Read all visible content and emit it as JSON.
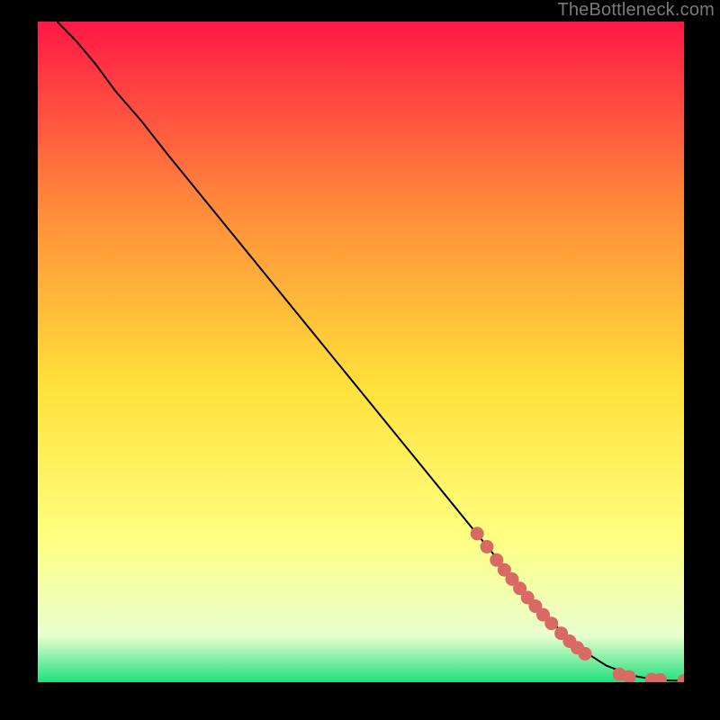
{
  "watermark": "TheBottleneck.com",
  "colors": {
    "gradient_top": "#ff1846",
    "gradient_mid_upper": "#ff8a3a",
    "gradient_mid": "#ffe13a",
    "gradient_mid_lower": "#ffff80",
    "gradient_lower": "#e8ffcf",
    "gradient_bottom": "#1fe07e",
    "curve": "#000000",
    "marker": "#d86a63",
    "frame": "#000000"
  },
  "chart_data": {
    "type": "line",
    "title": "",
    "xlabel": "",
    "ylabel": "",
    "xlim": [
      0,
      100
    ],
    "ylim": [
      0,
      100
    ],
    "series": [
      {
        "name": "curve",
        "x": [
          3,
          6,
          9,
          12,
          16,
          20,
          30,
          40,
          50,
          60,
          70,
          78,
          84,
          88,
          92,
          96,
          100
        ],
        "y": [
          100,
          97,
          93.5,
          89.5,
          85,
          80,
          68,
          56,
          44,
          32,
          20,
          10.5,
          5,
          2.5,
          1,
          0.3,
          0.2
        ]
      }
    ],
    "markers": [
      {
        "x": 68,
        "y": 22.5
      },
      {
        "x": 69.5,
        "y": 20.5
      },
      {
        "x": 71,
        "y": 18.5
      },
      {
        "x": 72.2,
        "y": 17
      },
      {
        "x": 73.4,
        "y": 15.6
      },
      {
        "x": 74.6,
        "y": 14.2
      },
      {
        "x": 75.8,
        "y": 12.8
      },
      {
        "x": 77,
        "y": 11.5
      },
      {
        "x": 78.2,
        "y": 10.2
      },
      {
        "x": 79.5,
        "y": 8.9
      },
      {
        "x": 81,
        "y": 7.4
      },
      {
        "x": 82.3,
        "y": 6.2
      },
      {
        "x": 83.5,
        "y": 5.2
      },
      {
        "x": 84.7,
        "y": 4.3
      },
      {
        "x": 90,
        "y": 1.2
      },
      {
        "x": 91.5,
        "y": 0.8
      },
      {
        "x": 95,
        "y": 0.4
      },
      {
        "x": 96.3,
        "y": 0.35
      },
      {
        "x": 100,
        "y": 0.2
      }
    ]
  }
}
